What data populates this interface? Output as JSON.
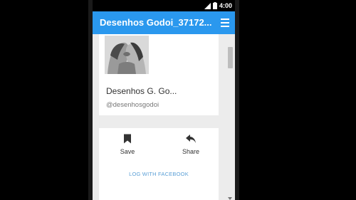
{
  "statusbar": {
    "time": "4:00",
    "icons": [
      "signal-icon",
      "battery-icon"
    ]
  },
  "appbar": {
    "title": "Desenhos Godoi_37172...",
    "menu_icon": "hamburger-menu-icon",
    "color": "#2a98ee"
  },
  "profile": {
    "name": "Desenhos G. Go...",
    "handle": "@desenhosgodoi",
    "avatar_description": "avatar-image"
  },
  "actions": {
    "save_label": "Save",
    "save_icon": "bookmark-icon",
    "share_label": "Share",
    "share_icon": "reply-share-icon"
  },
  "facebook": {
    "link_label": "LOG WITH FACEBOOK",
    "color": "#5a9fd6"
  }
}
